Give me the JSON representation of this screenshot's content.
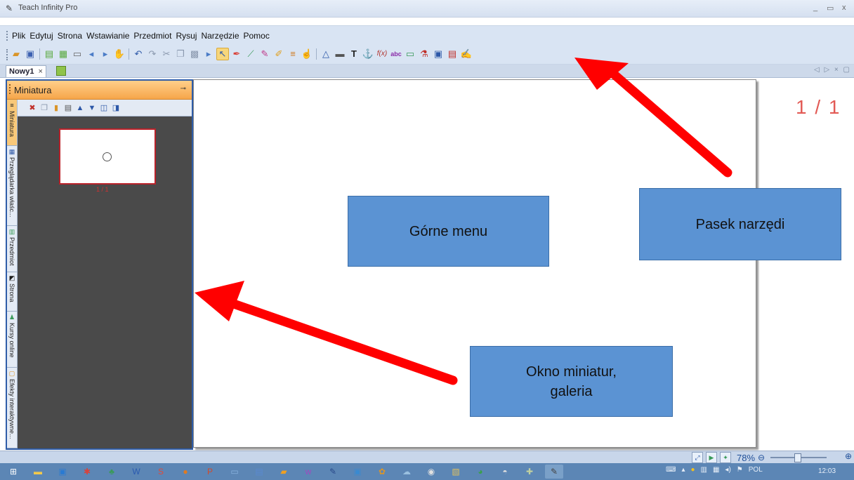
{
  "window": {
    "title": "Teach Infinity Pro",
    "controls": [
      "_",
      "▭",
      "x"
    ]
  },
  "menu": {
    "items": [
      "Plik",
      "Edytuj",
      "Strona",
      "Wstawianie",
      "Przedmiot",
      "Rysuj",
      "Narzędzie",
      "Pomoc"
    ]
  },
  "toolbar": {
    "icons": [
      "folder-open-icon",
      "save-icon",
      "new-page-icon",
      "new-page-green-icon",
      "page-icon",
      "prev-page-icon",
      "next-page-icon",
      "hand-icon",
      "undo-icon",
      "redo-icon",
      "cut-icon",
      "copy-icon",
      "paste-icon",
      "insert-page-icon",
      "select-arrow-icon",
      "pen-icon",
      "ruler-icon",
      "brush-icon",
      "highlighter-icon",
      "eraser-text-icon",
      "pointer-hand-icon",
      "triangle-icon",
      "video-icon",
      "text-icon",
      "anchor-icon",
      "function-icon",
      "abc-icon",
      "textbox-icon",
      "lab-flask-icon",
      "media-icon",
      "export-icon",
      "signature-icon"
    ]
  },
  "tabs": {
    "active": "Nowy1",
    "close": "×",
    "right_controls": "◁ ▷ × ▢"
  },
  "panel": {
    "title": "Miniatura",
    "vertical_tabs": [
      "Miniatura",
      "Przeglądarka właśc...",
      "Przedmiot",
      "Strona",
      "Kursy online",
      "Efekty interaktywne..."
    ],
    "thumbnail_label": "1 / 1"
  },
  "page_indicator": "1 / 1",
  "callouts": {
    "top_menu": "Górne menu",
    "toolbar": "Pasek narzędi",
    "thumbnails_line1": "Okno miniatur,",
    "thumbnails_line2": "galeria"
  },
  "statusbar": {
    "zoom": "78%",
    "minus": "⊖",
    "plus": "⊕"
  },
  "taskbar": {
    "language": "POL",
    "clock": "12:03"
  },
  "colors": {
    "callout_fill": "#5b93d3",
    "arrow": "#ff0000",
    "panel_header": "#f6a64a",
    "page_indicator": "#e25a55"
  }
}
